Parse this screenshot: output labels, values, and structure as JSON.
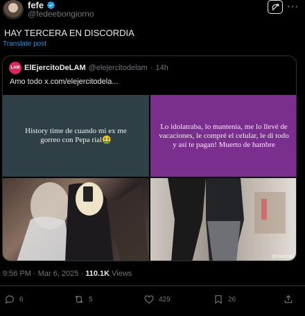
{
  "author": {
    "name": "fefe",
    "handle": "@fedeebongiorno"
  },
  "tweet": {
    "text": "HAY TERCERA EN DISCORDIA",
    "translate_label": "Translate post"
  },
  "quote": {
    "avatar_text": "LAM",
    "name": "ElEjercitoDeLAM",
    "handle": "@elejercitodelam",
    "separator": "·",
    "time": "14h",
    "text": "Amo todo  x.com/elejercitodela...",
    "media": {
      "tile1_text": "History time de cuando mi ex me gorreo con Pepa rial🤮",
      "tile2_text": "Lo idolatraba, lo mantenía, me lo llevé de vacaciones, le compré el celular, le di todo y así te pagan! Muerto de hambre",
      "watermark": "@nsorcial"
    }
  },
  "meta": {
    "timestamp": "9:56 PM · Mar 6, 2025 · ",
    "views_count": "110.1K",
    "views_label": " Views"
  },
  "actions": {
    "replies": "6",
    "reposts": "5",
    "likes": "429",
    "bookmarks": "26"
  },
  "colors": {
    "accent": "#1d9bf0",
    "background": "#000000",
    "border": "#2f3336",
    "muted": "#71767b"
  }
}
